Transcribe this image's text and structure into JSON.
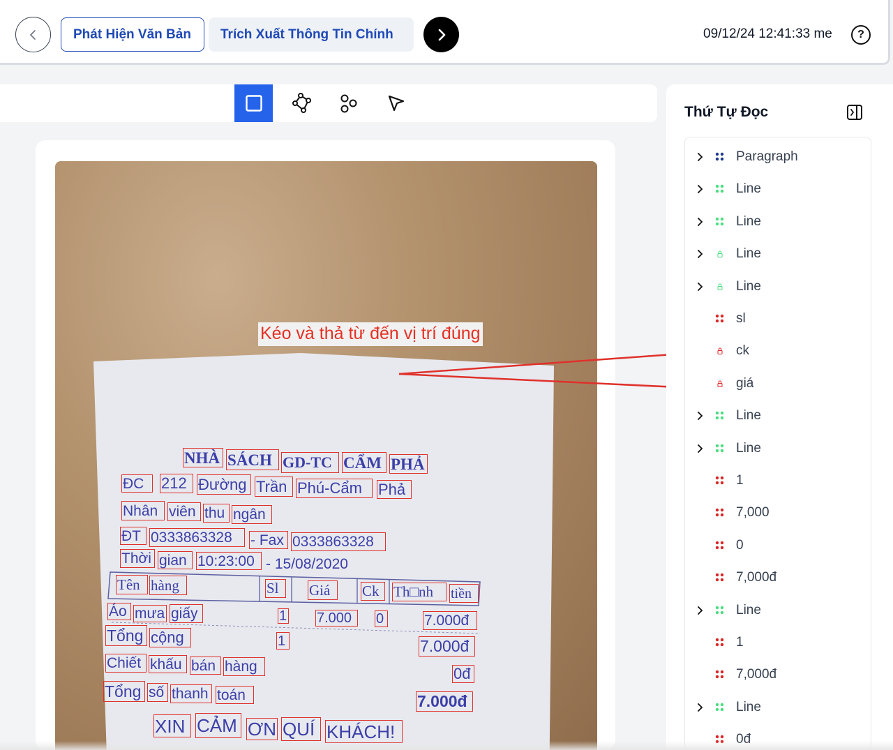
{
  "header": {
    "back_icon": "chevron-left-icon",
    "steps": [
      {
        "label": "Phát Hiện Văn Bản",
        "active": true
      },
      {
        "label": "Trích Xuất Thông Tin Chính",
        "active": false
      }
    ],
    "next_icon": "chevron-right-icon",
    "timestamp": "09/12/24 12:41:33 me",
    "help_icon": "question-circle-icon"
  },
  "toolbar": {
    "tools": [
      {
        "name": "rectangle-tool",
        "icon": "square-icon",
        "active": true
      },
      {
        "name": "polygon-tool",
        "icon": "polygon-nodes-icon",
        "active": false
      },
      {
        "name": "points-tool",
        "icon": "circles-icon",
        "active": false
      },
      {
        "name": "select-tool",
        "icon": "cursor-arrow-icon",
        "active": false
      }
    ],
    "active_color": "#2563eb"
  },
  "canvas": {
    "hint": "Kéo và thả từ đến vị trí đúng",
    "hint_color": "#e53124",
    "box_color": "#e0312b",
    "text_color": "#3b3fa8",
    "words": [
      "NHÀ",
      "SÁCH",
      "GD-TC",
      "CẨM",
      "PHẢ",
      "ĐC",
      "212",
      "Đường",
      "Trần",
      "Phú-Cẩm",
      "Phả",
      "Nhân",
      "viên",
      "thu",
      "ngân",
      "ĐT",
      "0333863328",
      "- Fax",
      "0333863328",
      "Thời",
      "gian",
      "10:23:00",
      "- 15/08/2020",
      "Tên",
      "hàng",
      "Sl",
      "Giá",
      "Ck",
      "Th□nh",
      "tiền",
      "Áo",
      "mưa",
      "giấy",
      "1",
      "7.000",
      "0",
      "7.000đ",
      "Tổng",
      "cộng",
      "1",
      "7.000đ",
      "Chiết",
      "khấu",
      "bán",
      "hàng",
      "0đ",
      "Tổng",
      "số",
      "thanh",
      "toán",
      "7.000đ",
      "XIN",
      "CẢM",
      "ƠN",
      "QUÍ",
      "KHÁCH!"
    ]
  },
  "panel": {
    "title": "Thứ Tự Đọc",
    "toggle_icon": "panel-collapse-icon",
    "items": [
      {
        "label": "Paragraph",
        "expandable": true,
        "grip": "navy"
      },
      {
        "label": "Line",
        "expandable": true,
        "grip": "green"
      },
      {
        "label": "Line",
        "expandable": true,
        "grip": "green"
      },
      {
        "label": "Line",
        "expandable": true,
        "grip": "lock-green"
      },
      {
        "label": "Line",
        "expandable": true,
        "grip": "lock-green"
      },
      {
        "label": "sl",
        "expandable": false,
        "grip": "red"
      },
      {
        "label": "ck",
        "expandable": false,
        "grip": "lock-red"
      },
      {
        "label": "giá",
        "expandable": false,
        "grip": "lock-red"
      },
      {
        "label": "Line",
        "expandable": true,
        "grip": "green"
      },
      {
        "label": "Line",
        "expandable": true,
        "grip": "green"
      },
      {
        "label": "1",
        "expandable": false,
        "grip": "red"
      },
      {
        "label": "7,000",
        "expandable": false,
        "grip": "red"
      },
      {
        "label": "0",
        "expandable": false,
        "grip": "red"
      },
      {
        "label": "7,000đ",
        "expandable": false,
        "grip": "red"
      },
      {
        "label": "Line",
        "expandable": true,
        "grip": "green"
      },
      {
        "label": "1",
        "expandable": false,
        "grip": "red"
      },
      {
        "label": "7,000đ",
        "expandable": false,
        "grip": "red"
      },
      {
        "label": "Line",
        "expandable": true,
        "grip": "green"
      },
      {
        "label": "0đ",
        "expandable": false,
        "grip": "red"
      }
    ],
    "grip_colors": {
      "navy": "#1e3a8a",
      "green": "#4ade80",
      "red": "#dc2626"
    }
  }
}
